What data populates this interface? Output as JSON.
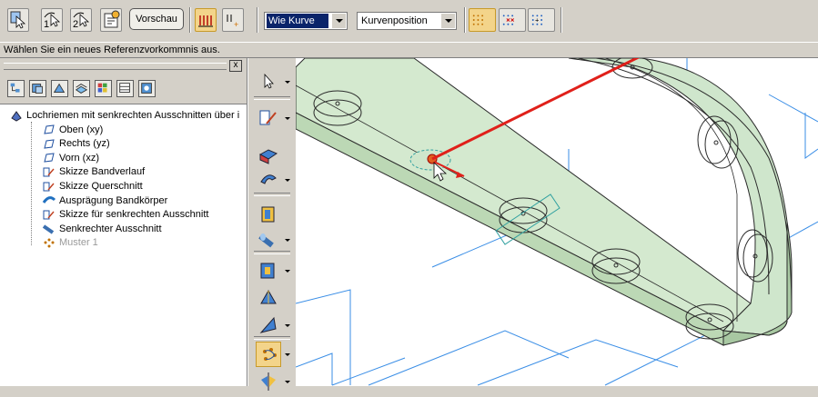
{
  "toolbar": {
    "preview_label": "Vorschau",
    "curve_combo_value": "Wie Kurve",
    "position_combo_value": "Kurvenposition",
    "icons": [
      "select-icon",
      "step1-icon",
      "step2-icon",
      "properties-icon",
      "array-icon",
      "spacing-icon",
      "grid-fill-icon",
      "grid-remove-icon",
      "grid-point-icon"
    ]
  },
  "status_bar": {
    "message": "Wählen Sie ein neues Referenzvorkommnis aus."
  },
  "panel": {
    "close_label": "x",
    "icons": [
      "tree-icon",
      "part-icon",
      "assembly-icon",
      "layer-icon",
      "color-icon",
      "table-icon",
      "view-icon"
    ],
    "tree": [
      {
        "label": "Lochriemen mit senkrechten Ausschnitten über i",
        "icon": "part-icon",
        "indent": 0,
        "dim": false
      },
      {
        "label": "Oben (xy)",
        "icon": "plane-icon",
        "indent": 1,
        "dim": false
      },
      {
        "label": "Rechts (yz)",
        "icon": "plane-icon",
        "indent": 1,
        "dim": false
      },
      {
        "label": "Vorn (xz)",
        "icon": "plane-icon",
        "indent": 1,
        "dim": false
      },
      {
        "label": "Skizze Bandverlauf",
        "icon": "sketch-icon",
        "indent": 1,
        "dim": false
      },
      {
        "label": "Skizze Querschnitt",
        "icon": "sketch-icon",
        "indent": 1,
        "dim": false
      },
      {
        "label": "Ausprägung Bandkörper",
        "icon": "sweep-icon",
        "indent": 1,
        "dim": false
      },
      {
        "label": "Skizze für senkrechten Ausschnitt",
        "icon": "sketch-icon",
        "indent": 1,
        "dim": false
      },
      {
        "label": "Senkrechter Ausschnitt",
        "icon": "cutout-icon",
        "indent": 1,
        "dim": false
      },
      {
        "label": "Muster 1",
        "icon": "pattern-icon",
        "indent": 1,
        "dim": true
      }
    ]
  },
  "vertical_toolbar": {
    "buttons": [
      "select-arrow-icon",
      "sketch-tool-icon",
      "protrusion-icon",
      "revolve-icon",
      "cutout-tool-icon",
      "hole-icon",
      "chamfer-icon",
      "loft-icon",
      "face-icon",
      "pattern-tool-icon",
      "mirror-icon"
    ]
  },
  "colors": {
    "accent": "#f3d48a",
    "part_fill": "#cfe6cc",
    "part_edge": "#2a2a2a",
    "sketch_line": "#3a8ee6",
    "pointer": "#e0201a"
  }
}
